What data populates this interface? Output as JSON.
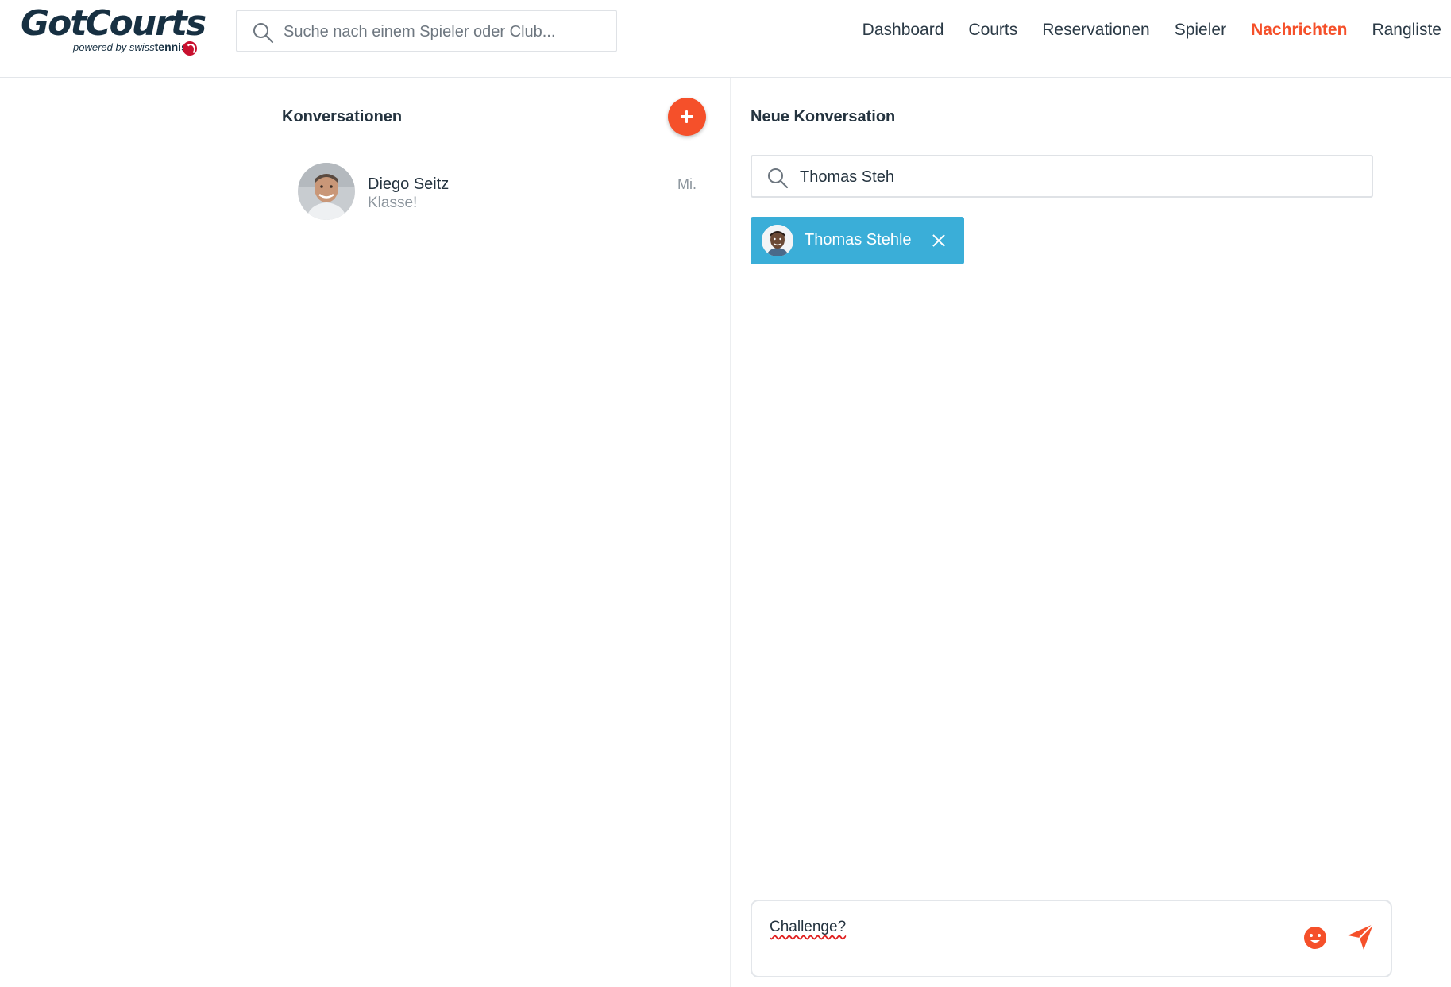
{
  "brand": {
    "name": "GotCourts",
    "powered_by": "powered by",
    "partner_light": "swiss",
    "partner_bold": "tennis"
  },
  "search": {
    "placeholder": "Suche nach einem Spieler oder Club..."
  },
  "nav": {
    "items": [
      "Dashboard",
      "Courts",
      "Reservationen",
      "Spieler",
      "Nachrichten",
      "Rangliste"
    ],
    "active": "Nachrichten"
  },
  "conversations": {
    "title": "Konversationen",
    "items": [
      {
        "name": "Diego Seitz",
        "last_message": "Klasse!",
        "date": "Mi."
      }
    ]
  },
  "new_conversation": {
    "title": "Neue Konversation",
    "search_value": "Thomas Steh",
    "selected_recipient": "Thomas Stehle"
  },
  "composer": {
    "value": "Challenge?"
  },
  "colors": {
    "accent": "#f5502a",
    "chip": "#3aaed8",
    "brand_dark": "#173042",
    "text": "#24333f",
    "muted": "#8c959d"
  },
  "icons": {
    "search": "search-icon",
    "add": "plus-icon",
    "close": "close-icon",
    "emoji": "emoji-icon",
    "send": "send-icon"
  }
}
